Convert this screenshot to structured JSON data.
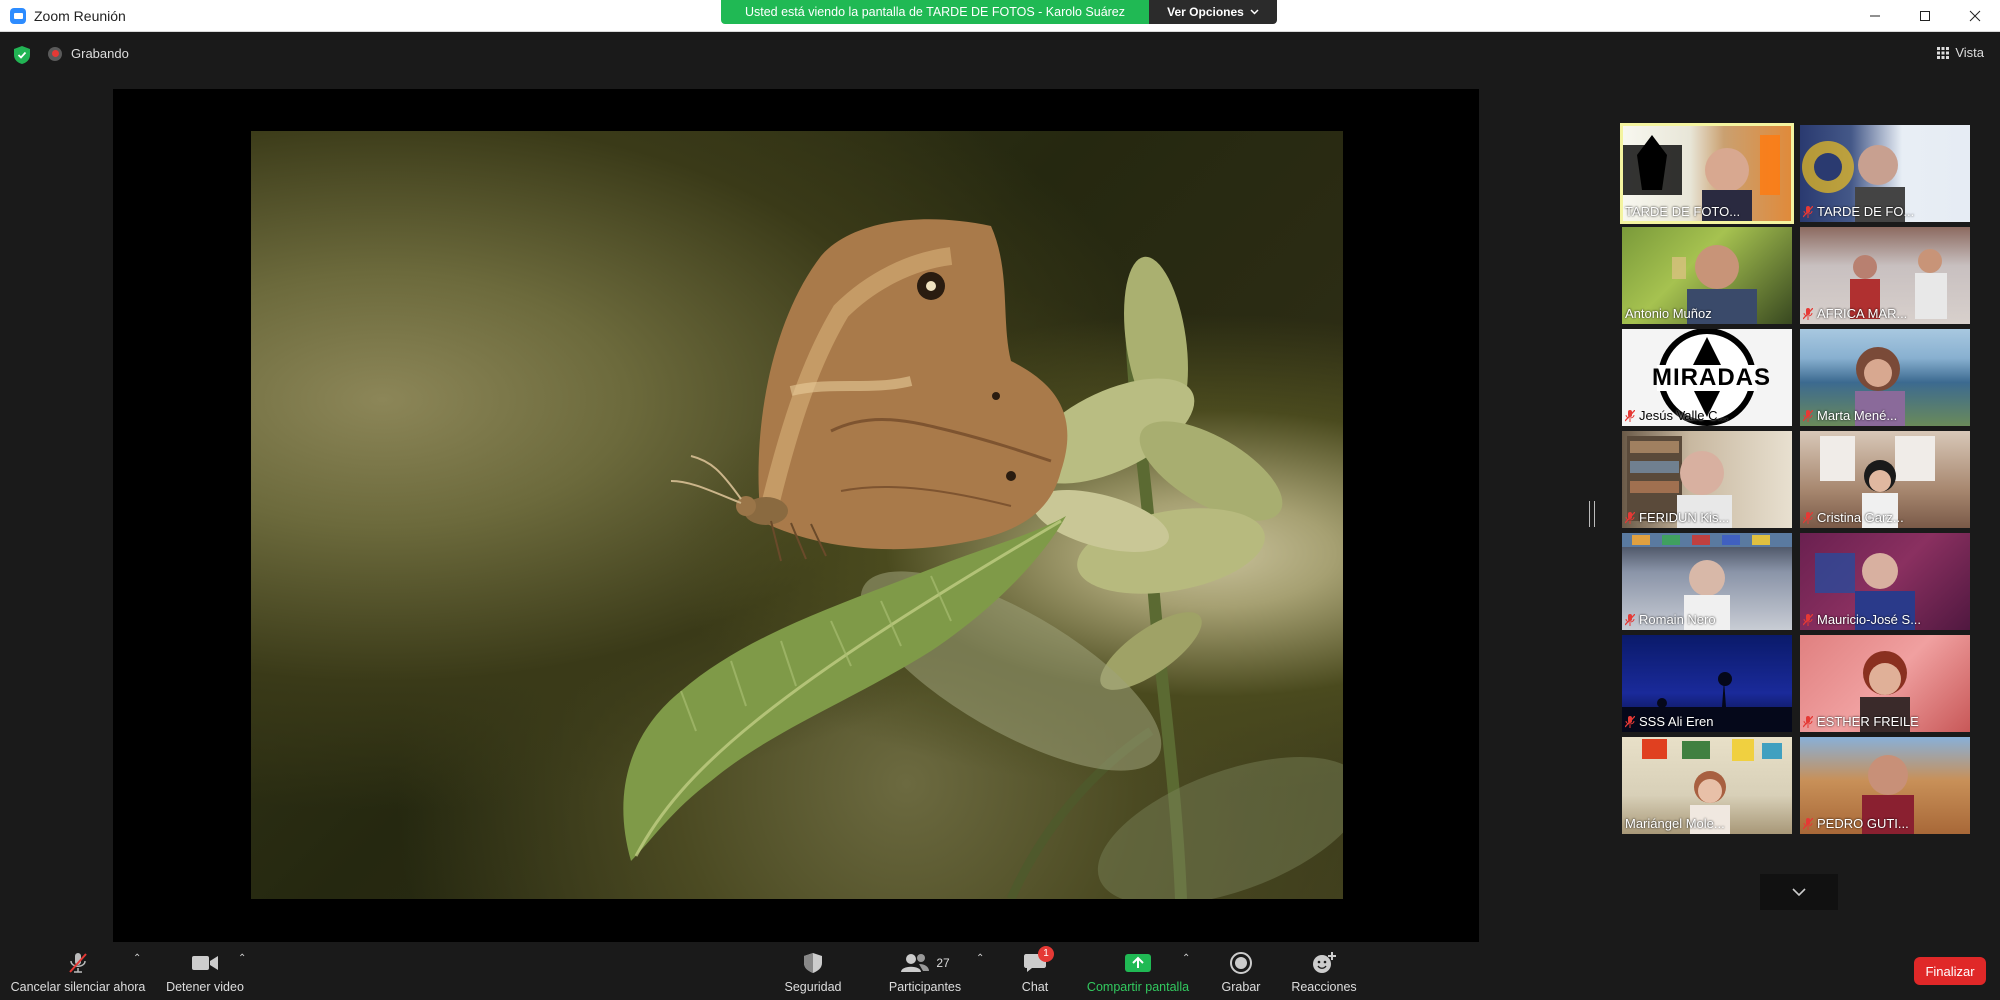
{
  "window": {
    "title": "Zoom Reunión",
    "share_banner": "Usted está viendo la pantalla de TARDE DE FOTOS - Karolo Suárez",
    "view_options": "Ver Opciones"
  },
  "meeting": {
    "recording_label": "Grabando",
    "view_label": "Vista"
  },
  "gallery": {
    "participants": [
      {
        "name": "TARDE DE FOTO...",
        "muted": false,
        "active": true
      },
      {
        "name": "TARDE DE FO...",
        "muted": true,
        "active": false
      },
      {
        "name": "Antonio Muñoz",
        "muted": false,
        "active": false
      },
      {
        "name": "AFRICA MAR...",
        "muted": true,
        "active": false
      },
      {
        "name": "Jesús Valle C...",
        "muted": true,
        "active": false
      },
      {
        "name": "Marta Mené...",
        "muted": true,
        "active": false
      },
      {
        "name": "FERIDUN Kis...",
        "muted": true,
        "active": false
      },
      {
        "name": "Cristina Garz...",
        "muted": true,
        "active": false
      },
      {
        "name": "Romain Nero",
        "muted": true,
        "active": false
      },
      {
        "name": "Mauricio-José S...",
        "muted": true,
        "active": false
      },
      {
        "name": "SSS Ali Eren",
        "muted": true,
        "active": false
      },
      {
        "name": "ESTHER FREILE",
        "muted": true,
        "active": false
      },
      {
        "name": "Mariángel Mole...",
        "muted": false,
        "active": false
      },
      {
        "name": "PEDRO GUTI...",
        "muted": true,
        "active": false
      }
    ],
    "tile_overlays": {
      "miradas_logo": "MIRADAS"
    }
  },
  "toolbar": {
    "unmute_label": "Cancelar silenciar ahora",
    "stop_video_label": "Detener video",
    "security_label": "Seguridad",
    "participants_label": "Participantes",
    "participants_count": "27",
    "chat_label": "Chat",
    "chat_badge": "1",
    "share_label": "Compartir pantalla",
    "record_label": "Grabar",
    "reactions_label": "Reacciones",
    "end_label": "Finalizar"
  },
  "colors": {
    "share_green": "#20b954",
    "end_red": "#e02828",
    "active_speaker": "#f4f4a0"
  }
}
